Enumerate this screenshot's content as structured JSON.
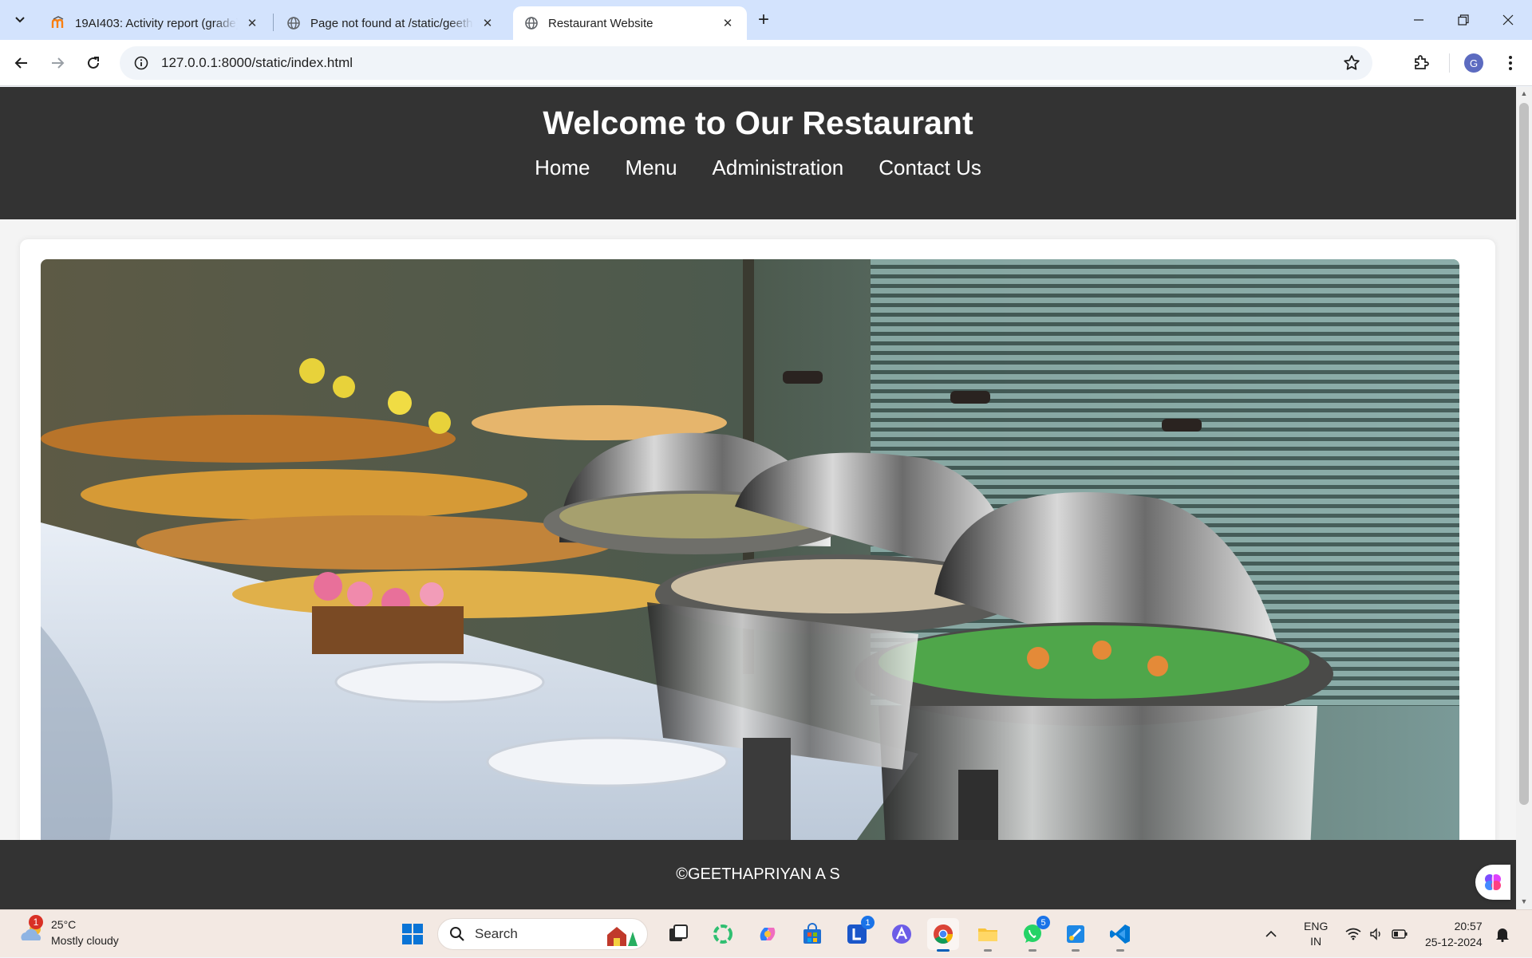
{
  "browser": {
    "tabs": [
      {
        "title": "19AI403: Activity report (grade)",
        "favicon": "moodle-icon",
        "active": false
      },
      {
        "title": "Page not found at /static/geethapriyan",
        "favicon": "globe-icon",
        "active": false
      },
      {
        "title": "Restaurant Website",
        "favicon": "globe-icon",
        "active": true
      }
    ],
    "url": "127.0.0.1:8000/static/index.html",
    "profile_initial": "G"
  },
  "site": {
    "title": "Welcome to Our Restaurant",
    "nav": [
      "Home",
      "Menu",
      "Administration",
      "Contact Us"
    ],
    "hero_image": "buffet-table-photo",
    "footer": "©GEETHAPRIYAN A S"
  },
  "taskbar": {
    "weather": {
      "temp": "25°C",
      "condition": "Mostly cloudy",
      "badge": "1"
    },
    "search_placeholder": "Search",
    "badges": {
      "teams": "1",
      "whatsapp": "5"
    },
    "language": {
      "line1": "ENG",
      "line2": "IN"
    },
    "time": "20:57",
    "date": "25-12-2024"
  },
  "colors": {
    "header_bg": "#333333",
    "tabstrip_bg": "#d3e3fd",
    "taskbar_bg": "#f3e9e3"
  }
}
